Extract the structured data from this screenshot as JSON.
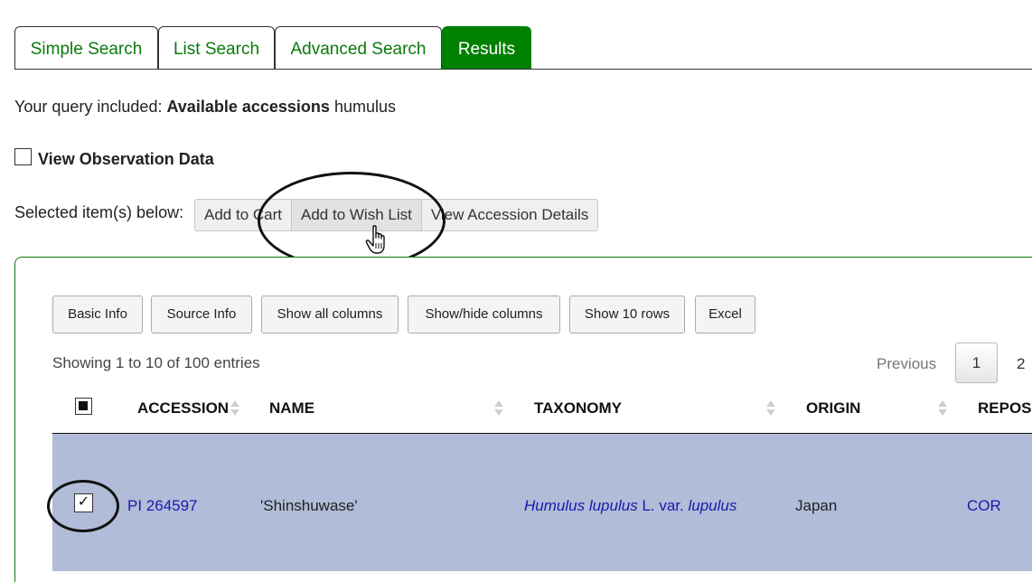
{
  "tabs": [
    {
      "label": "Simple Search"
    },
    {
      "label": "List Search"
    },
    {
      "label": "Advanced Search"
    },
    {
      "label": "Results"
    }
  ],
  "query": {
    "prefix": "Your query included:",
    "bold": "Available accessions",
    "term": "humulus"
  },
  "observation": {
    "label": "View Observation Data",
    "checked": false
  },
  "selection": {
    "label": "Selected item(s) below:",
    "buttons": [
      "Add to Cart",
      "Add to Wish List",
      "View Accession Details"
    ]
  },
  "toolbar": {
    "buttons": [
      "Basic Info",
      "Source Info",
      "Show all columns",
      "Show/hide columns",
      "Show 10 rows",
      "Excel"
    ]
  },
  "table": {
    "info": "Showing 1 to 10 of 100 entries",
    "pagination": {
      "previous": "Previous",
      "pages": [
        "1",
        "2"
      ],
      "current": "1"
    },
    "columns": [
      "ACCESSION",
      "NAME",
      "TAXONOMY",
      "ORIGIN",
      "REPOSI"
    ],
    "rows": [
      {
        "accession": "PI 264597",
        "name": "'Shinshuwase'",
        "taxonomy": {
          "genus": "Humulus",
          "species": "lupulus",
          "author": "L. var.",
          "variety": "lupulus"
        },
        "origin": "Japan",
        "repository": "COR",
        "selected": true
      }
    ]
  },
  "colors": {
    "tab_active": "#008000",
    "tab_text": "#0a7a0a",
    "link": "#1a1aaa",
    "row_selected": "#b0bcd8"
  }
}
